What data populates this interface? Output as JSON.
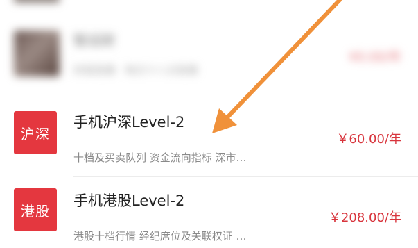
{
  "blurred_item": {
    "title": "智远财",
    "subtitle": "财富直播 · 每日十八点直播",
    "price": "¥0.00/年"
  },
  "items": [
    {
      "icon_text": "沪深",
      "title": "手机沪深Level-2",
      "subtitle": "十档及买卖队列 资金流向指标 深市…",
      "price": "￥60.00/年"
    },
    {
      "icon_text": "港股",
      "title": "手机港股Level-2",
      "subtitle": "港股十档行情 经纪席位及关联权证 …",
      "price": "￥208.00/年"
    }
  ],
  "colors": {
    "tile": "#e4373f",
    "price": "#d8353d",
    "arrow": "#f0913a"
  }
}
